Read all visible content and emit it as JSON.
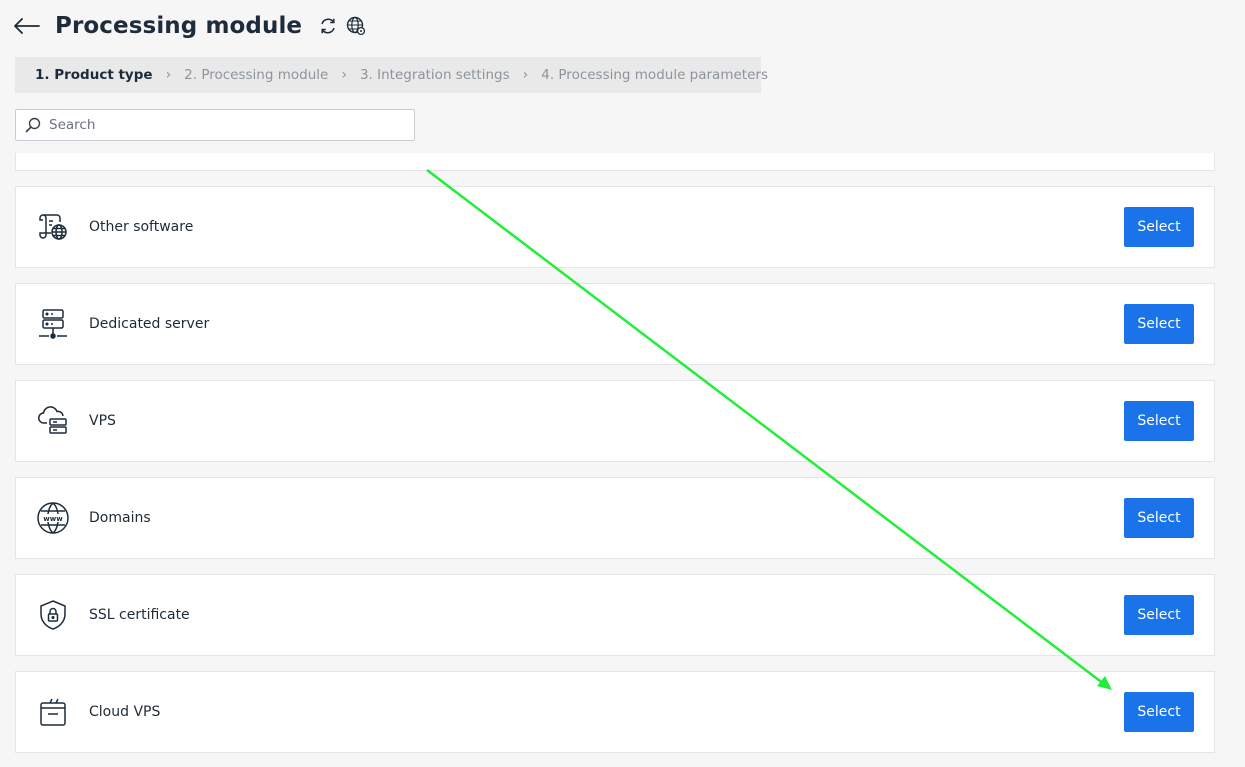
{
  "header": {
    "title": "Processing module",
    "back_icon": "arrow-left-icon",
    "refresh_icon": "refresh-icon",
    "globe_icon": "globe-settings-icon"
  },
  "steps": [
    {
      "label": "1. Product type",
      "active": true
    },
    {
      "label": "2. Processing module",
      "active": false
    },
    {
      "label": "3. Integration settings",
      "active": false
    },
    {
      "label": "4. Processing module parameters",
      "active": false
    }
  ],
  "search": {
    "placeholder": "Search",
    "value": ""
  },
  "products": [
    {
      "label": "Other software",
      "icon": "software-globe-icon",
      "button": "Select"
    },
    {
      "label": "Dedicated server",
      "icon": "server-icon",
      "button": "Select"
    },
    {
      "label": "VPS",
      "icon": "cloud-server-icon",
      "button": "Select"
    },
    {
      "label": "Domains",
      "icon": "www-globe-icon",
      "button": "Select"
    },
    {
      "label": "SSL certificate",
      "icon": "shield-lock-icon",
      "button": "Select"
    },
    {
      "label": "Cloud VPS",
      "icon": "cloud-box-icon",
      "button": "Select"
    }
  ],
  "colors": {
    "accent": "#1a73e8",
    "annotation_arrow": "#22ee3a",
    "background": "#f6f6f6"
  }
}
